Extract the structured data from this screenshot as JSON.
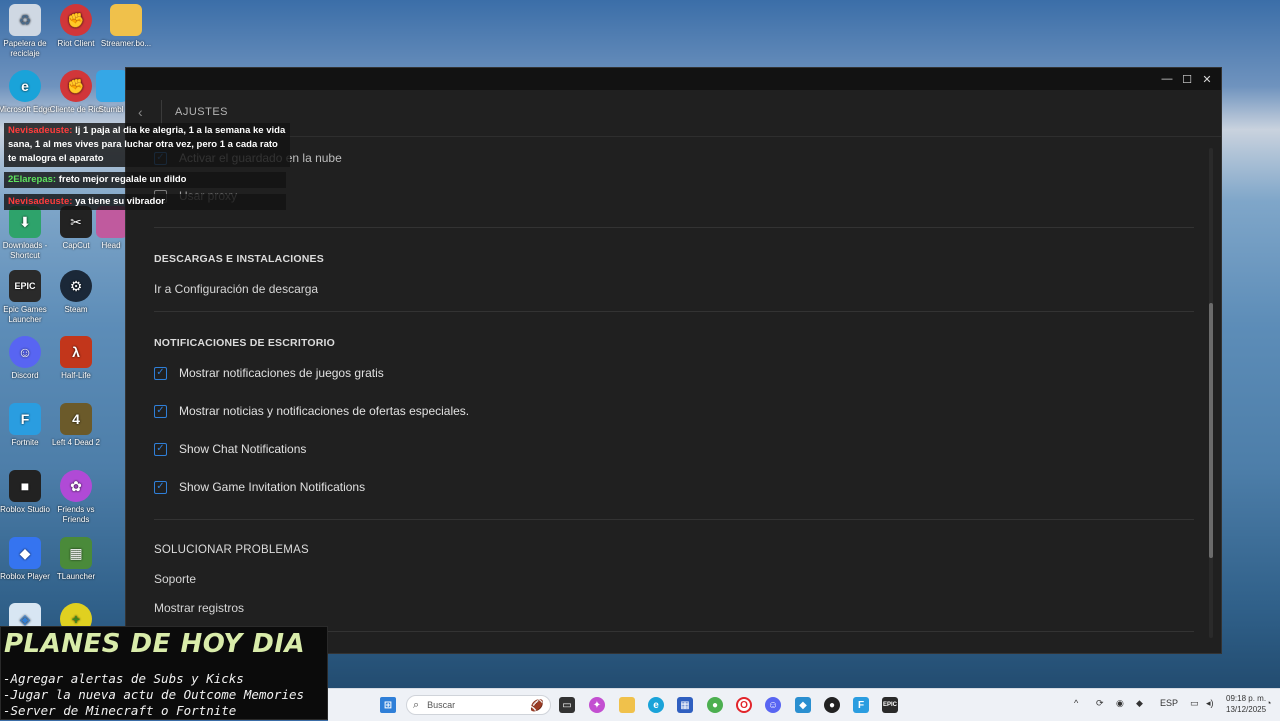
{
  "desktop_icons": [
    {
      "label": "Papelera de reciclaje",
      "icon": "recycle-bin-icon",
      "color": "#cfd8e3"
    },
    {
      "label": "Riot Client",
      "icon": "riot-client-icon",
      "color": "#d13639"
    },
    {
      "label": "Streamer.bo...",
      "icon": "folder-icon",
      "color": "#f0c14b"
    },
    {
      "label": "Microsoft Edge",
      "icon": "edge-icon",
      "color": "#1aa3d9"
    },
    {
      "label": "Cliente de Riot",
      "icon": "riot-client-icon",
      "color": "#d13639"
    },
    {
      "label": "Stumbl",
      "icon": "stumble-icon",
      "color": "#35a7e6"
    },
    {
      "label": "Downloads - Shortcut",
      "icon": "downloads-icon",
      "color": "#2ea36b"
    },
    {
      "label": "CapCut",
      "icon": "capcut-icon",
      "color": "#222222"
    },
    {
      "label": "Head",
      "icon": "app-icon",
      "color": "#c05a9e"
    },
    {
      "label": "Epic Games Launcher",
      "icon": "epic-games-icon",
      "color": "#2a2a2a"
    },
    {
      "label": "Steam",
      "icon": "steam-icon",
      "color": "#1b2838"
    },
    {
      "label": "Discord",
      "icon": "discord-icon",
      "color": "#5865f2"
    },
    {
      "label": "Half-Life",
      "icon": "half-life-icon",
      "color": "#c2361b"
    },
    {
      "label": "Fortnite",
      "icon": "fortnite-icon",
      "color": "#2a9de0"
    },
    {
      "label": "Left 4 Dead 2",
      "icon": "l4d2-icon",
      "color": "#6b5a2a"
    },
    {
      "label": "Roblox Studio",
      "icon": "roblox-studio-icon",
      "color": "#222222"
    },
    {
      "label": "Friends vs Friends",
      "icon": "friends-vs-friends-icon",
      "color": "#b04ad6"
    },
    {
      "label": "Roblox Player",
      "icon": "roblox-player-icon",
      "color": "#3574f0"
    },
    {
      "label": "TLauncher",
      "icon": "tlauncher-icon",
      "color": "#4a8a3a"
    }
  ],
  "chat": [
    {
      "user": "Nevisadeuste:",
      "text": "lj 1 paja al dia ke alegria, 1 a la semana ke vida sana, 1 al mes vives para luchar otra vez, pero 1 a cada rato te malogra el aparato"
    },
    {
      "user": "2Elarepas:",
      "text": "freto mejor regalale un dildo"
    },
    {
      "user": "Nevisadeuste:",
      "text": "ya tiene su vibrador"
    }
  ],
  "window": {
    "header_title": "AJUSTES",
    "cloud_save_label": "Activar el guardado en la nube",
    "proxy_label": "Usar proxy",
    "downloads_section": "DESCARGAS E INSTALACIONES",
    "downloads_link": "Ir a Configuración de descarga",
    "notifications_section": "NOTIFICACIONES DE ESCRITORIO",
    "notifications": [
      {
        "label": "Mostrar notificaciones de juegos gratis",
        "checked": true
      },
      {
        "label": "Mostrar noticias y notificaciones de ofertas especiales.",
        "checked": true
      },
      {
        "label": "Show Chat Notifications",
        "checked": true
      },
      {
        "label": "Show Game Invitation Notifications",
        "checked": true
      }
    ],
    "troubleshoot_section": "SOLUCIONAR PROBLEMAS",
    "support_link": "Soporte",
    "logs_link": "Mostrar registros",
    "accent_color": "#2f7fd8"
  },
  "planes": {
    "title": "PLANES DE HOY DIA",
    "lines": [
      "-Agregar alertas de Subs y Kicks",
      "-Jugar la nueva actu de Outcome Memories",
      "-Server de Minecraft o Fortnite"
    ]
  },
  "taskbar": {
    "search_placeholder": "Buscar",
    "language": "ESP",
    "time": "09:18 p. m.",
    "date": "13/12/2025"
  }
}
